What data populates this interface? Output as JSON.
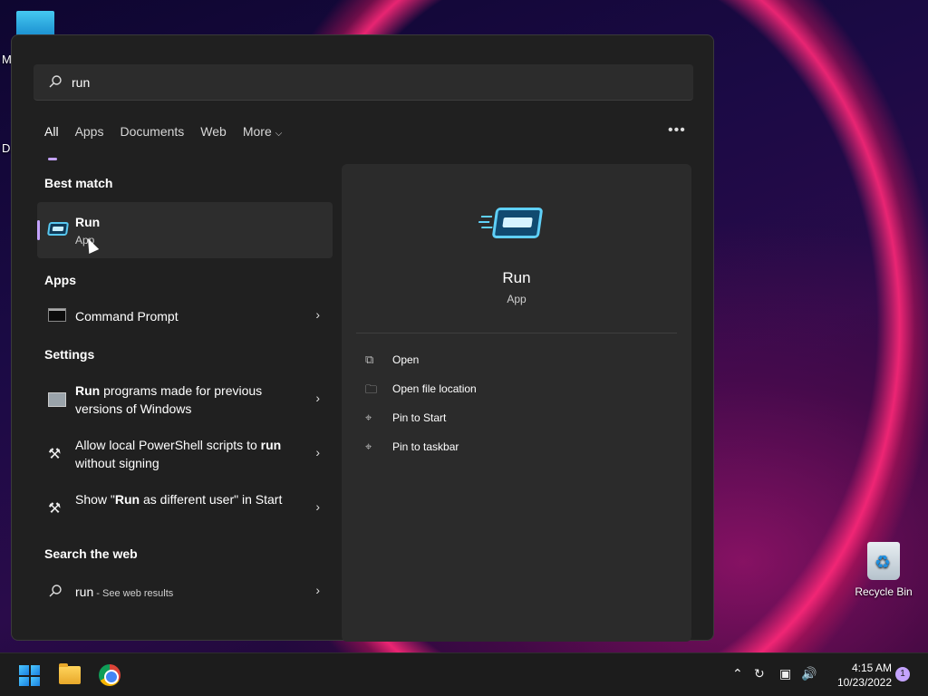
{
  "desktop": {
    "partial_label_top": "M",
    "partial_label_mid": "Da",
    "recycle_bin_label": "Recycle Bin"
  },
  "search": {
    "query": "run"
  },
  "tabs": [
    {
      "label": "All",
      "active": true
    },
    {
      "label": "Apps"
    },
    {
      "label": "Documents"
    },
    {
      "label": "Web"
    },
    {
      "label": "More"
    }
  ],
  "sections": {
    "best_match": "Best match",
    "apps": "Apps",
    "settings": "Settings",
    "search_web": "Search the web"
  },
  "best_match": {
    "name": "Run",
    "type": "App"
  },
  "apps": [
    {
      "label": "Command Prompt"
    }
  ],
  "settings": [
    {
      "bold": "Run",
      "rest": " programs made for previous versions of Windows"
    },
    {
      "pre": "Allow local PowerShell scripts to ",
      "bold": "run",
      "rest": " without signing"
    },
    {
      "pre": "Show \"",
      "bold": "Run",
      "rest": " as different user\" in Start"
    }
  ],
  "web": {
    "query": "run",
    "suffix": " - See web results"
  },
  "preview": {
    "title": "Run",
    "subtitle": "App",
    "actions": [
      {
        "label": "Open",
        "icon": "open-icon"
      },
      {
        "label": "Open file location",
        "icon": "folder-icon"
      },
      {
        "label": "Pin to Start",
        "icon": "pin-icon"
      },
      {
        "label": "Pin to taskbar",
        "icon": "pin-icon"
      }
    ]
  },
  "taskbar": {
    "time": "4:15 AM",
    "date": "10/23/2022",
    "notification_count": "1"
  },
  "colors": {
    "accent": "#c4a3ff",
    "panel": "#202020"
  }
}
